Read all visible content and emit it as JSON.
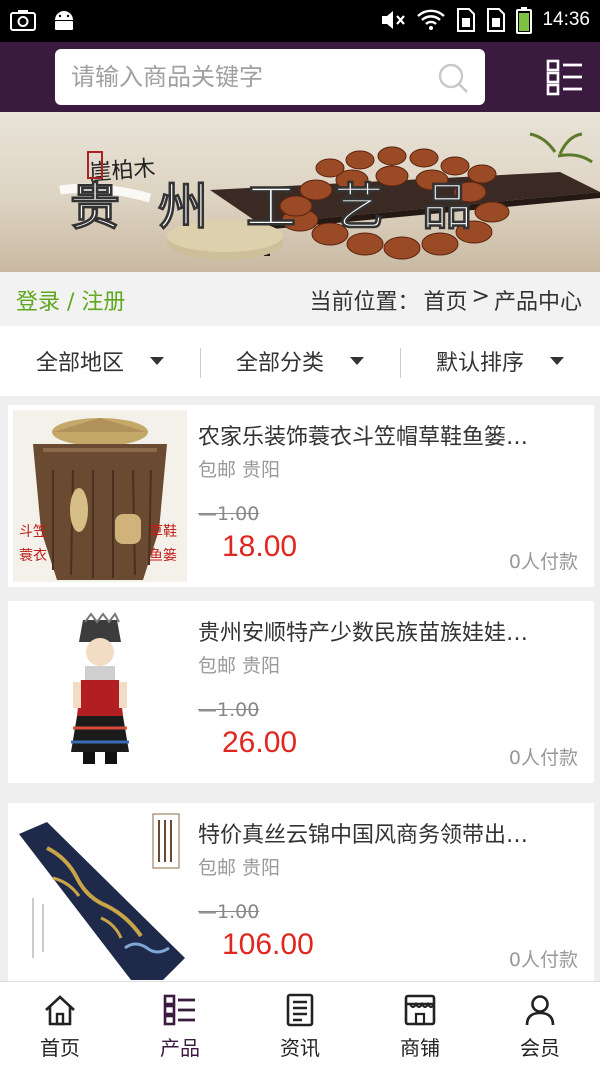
{
  "status_bar": {
    "time": "14:36",
    "icons": [
      "camera-icon",
      "android-icon",
      "mute-icon",
      "wifi-icon",
      "sim1-icon",
      "sim2-icon",
      "battery-icon"
    ]
  },
  "header": {
    "search_placeholder": "请输入商品关键字",
    "bg_color": "#3a1a3f"
  },
  "banner": {
    "title": "贵州工艺品",
    "subtitle": "崖柏木"
  },
  "breadcrumb": {
    "login_label": "登录 / 注册",
    "location_label": "当前位置：",
    "home": "首页",
    "separator": ">",
    "current": "产品中心"
  },
  "filters": [
    {
      "label": "全部地区"
    },
    {
      "label": "全部分类"
    },
    {
      "label": "默认排序"
    }
  ],
  "products": [
    {
      "title": "农家乐装饰蓑衣斗笠帽草鞋鱼篓…",
      "meta": "包邮 贵阳",
      "old_price": "1.00",
      "price": "18.00",
      "sold": "0人付款",
      "image_labels": [
        "斗笠",
        "蓑衣",
        "草鞋",
        "鱼篓"
      ]
    },
    {
      "title": "贵州安顺特产少数民族苗族娃娃…",
      "meta": "包邮 贵阳",
      "old_price": "1.00",
      "price": "26.00",
      "sold": "0人付款"
    },
    {
      "title": "特价真丝云锦中国风商务领带出…",
      "meta": "包邮 贵阳",
      "old_price": "1.00",
      "price": "106.00",
      "sold": "0人付款"
    }
  ],
  "tabs": [
    {
      "label": "首页",
      "icon": "home-icon"
    },
    {
      "label": "产品",
      "icon": "product-list-icon"
    },
    {
      "label": "资讯",
      "icon": "news-icon"
    },
    {
      "label": "商铺",
      "icon": "store-icon"
    },
    {
      "label": "会员",
      "icon": "user-icon"
    }
  ],
  "colors": {
    "accent": "#3a1a3f",
    "price": "#e0261f",
    "login": "#5fa81f"
  }
}
